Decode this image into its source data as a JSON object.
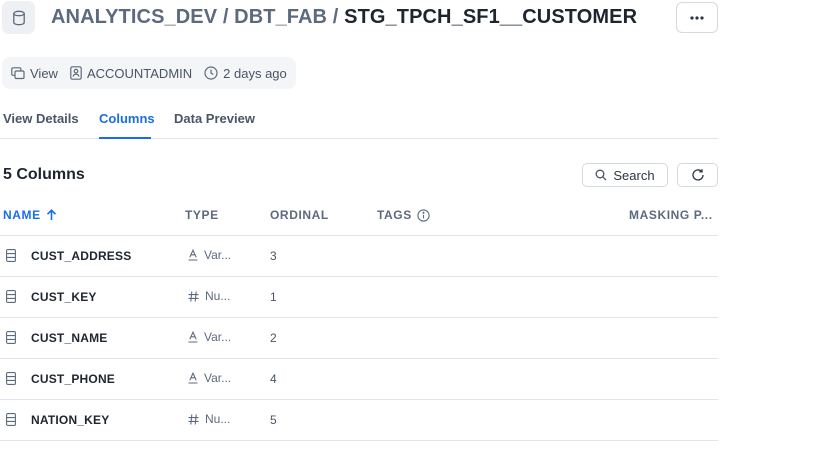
{
  "header": {
    "database": "ANALYTICS_DEV",
    "separator": "/",
    "schema": "DBT_FAB",
    "object": "STG_TPCH_SF1__CUSTOMER",
    "more_label": "···"
  },
  "meta": {
    "type": "View",
    "owner": "ACCOUNTADMIN",
    "modified": "2 days ago"
  },
  "tabs": [
    {
      "label": "View Details",
      "active": false
    },
    {
      "label": "Columns",
      "active": true
    },
    {
      "label": "Data Preview",
      "active": false
    }
  ],
  "columns_panel": {
    "count_label": "5 Columns",
    "search_label": "Search"
  },
  "table": {
    "headers": {
      "name": "NAME",
      "type": "TYPE",
      "ordinal": "ORDINAL",
      "tags": "TAGS",
      "masking": "MASKING P..."
    },
    "rows": [
      {
        "name": "CUST_ADDRESS",
        "type": "Var...",
        "type_icon": "text-type-icon",
        "ordinal": "3"
      },
      {
        "name": "CUST_KEY",
        "type": "Nu...",
        "type_icon": "number-type-icon",
        "ordinal": "1"
      },
      {
        "name": "CUST_NAME",
        "type": "Var...",
        "type_icon": "text-type-icon",
        "ordinal": "2"
      },
      {
        "name": "CUST_PHONE",
        "type": "Var...",
        "type_icon": "text-type-icon",
        "ordinal": "4"
      },
      {
        "name": "NATION_KEY",
        "type": "Nu...",
        "type_icon": "number-type-icon",
        "ordinal": "5"
      }
    ]
  },
  "colors": {
    "accent": "#1a6ce8",
    "text_primary": "#1e252f",
    "text_secondary": "#5d6a7d",
    "border": "#e1e4e8"
  }
}
